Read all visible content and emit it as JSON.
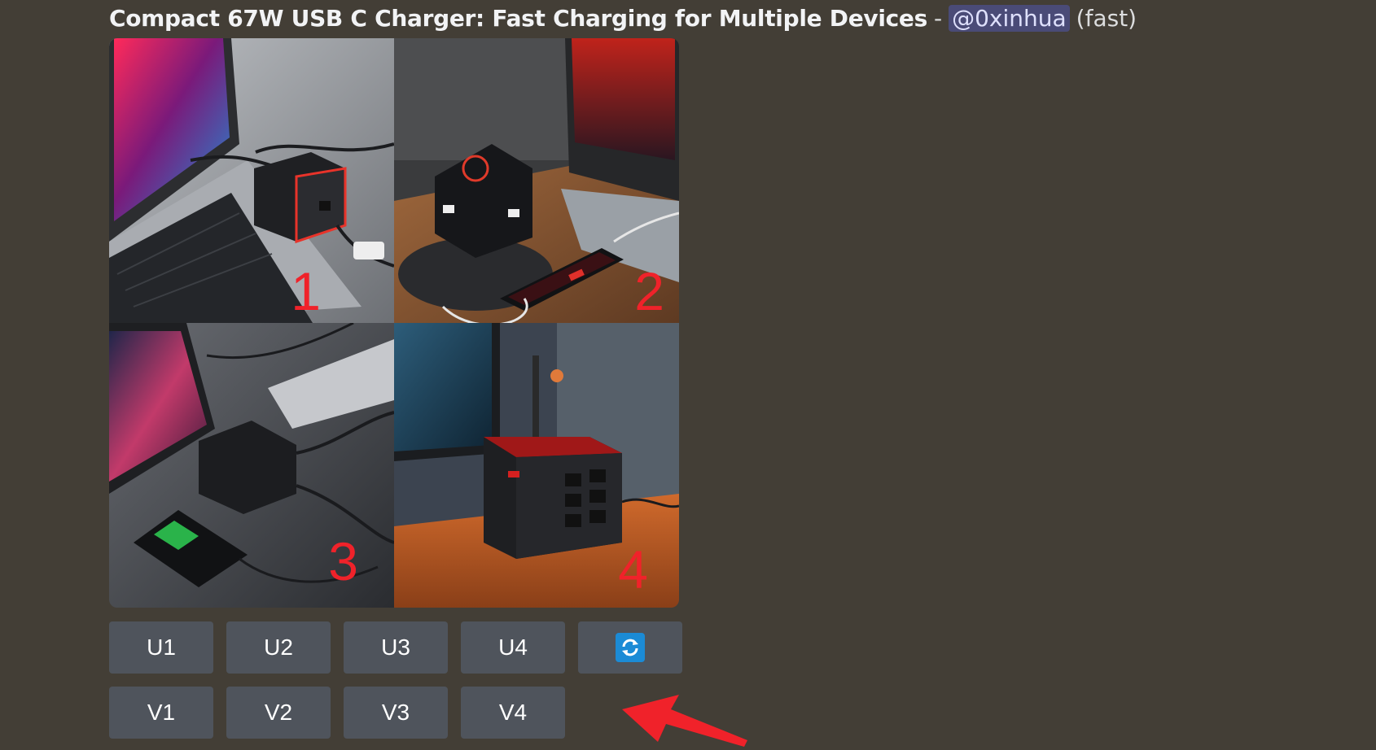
{
  "message": {
    "prompt": "Compact 67W USB C Charger: Fast Charging for Multiple Devices",
    "separator": "-",
    "mention": "@0xinhua",
    "speed": "(fast)"
  },
  "grid": {
    "tiles": [
      {
        "number": "1"
      },
      {
        "number": "2"
      },
      {
        "number": "3"
      },
      {
        "number": "4"
      }
    ]
  },
  "buttons": {
    "upscale": [
      "U1",
      "U2",
      "U3",
      "U4"
    ],
    "variation": [
      "V1",
      "V2",
      "V3",
      "V4"
    ],
    "reroll_icon": "refresh-icon"
  },
  "colors": {
    "background": "#433e36",
    "button": "#4f545c",
    "mention_bg": "#5865f2",
    "annotation_red": "#f0222a",
    "reroll_blue": "#1b8bd6"
  }
}
